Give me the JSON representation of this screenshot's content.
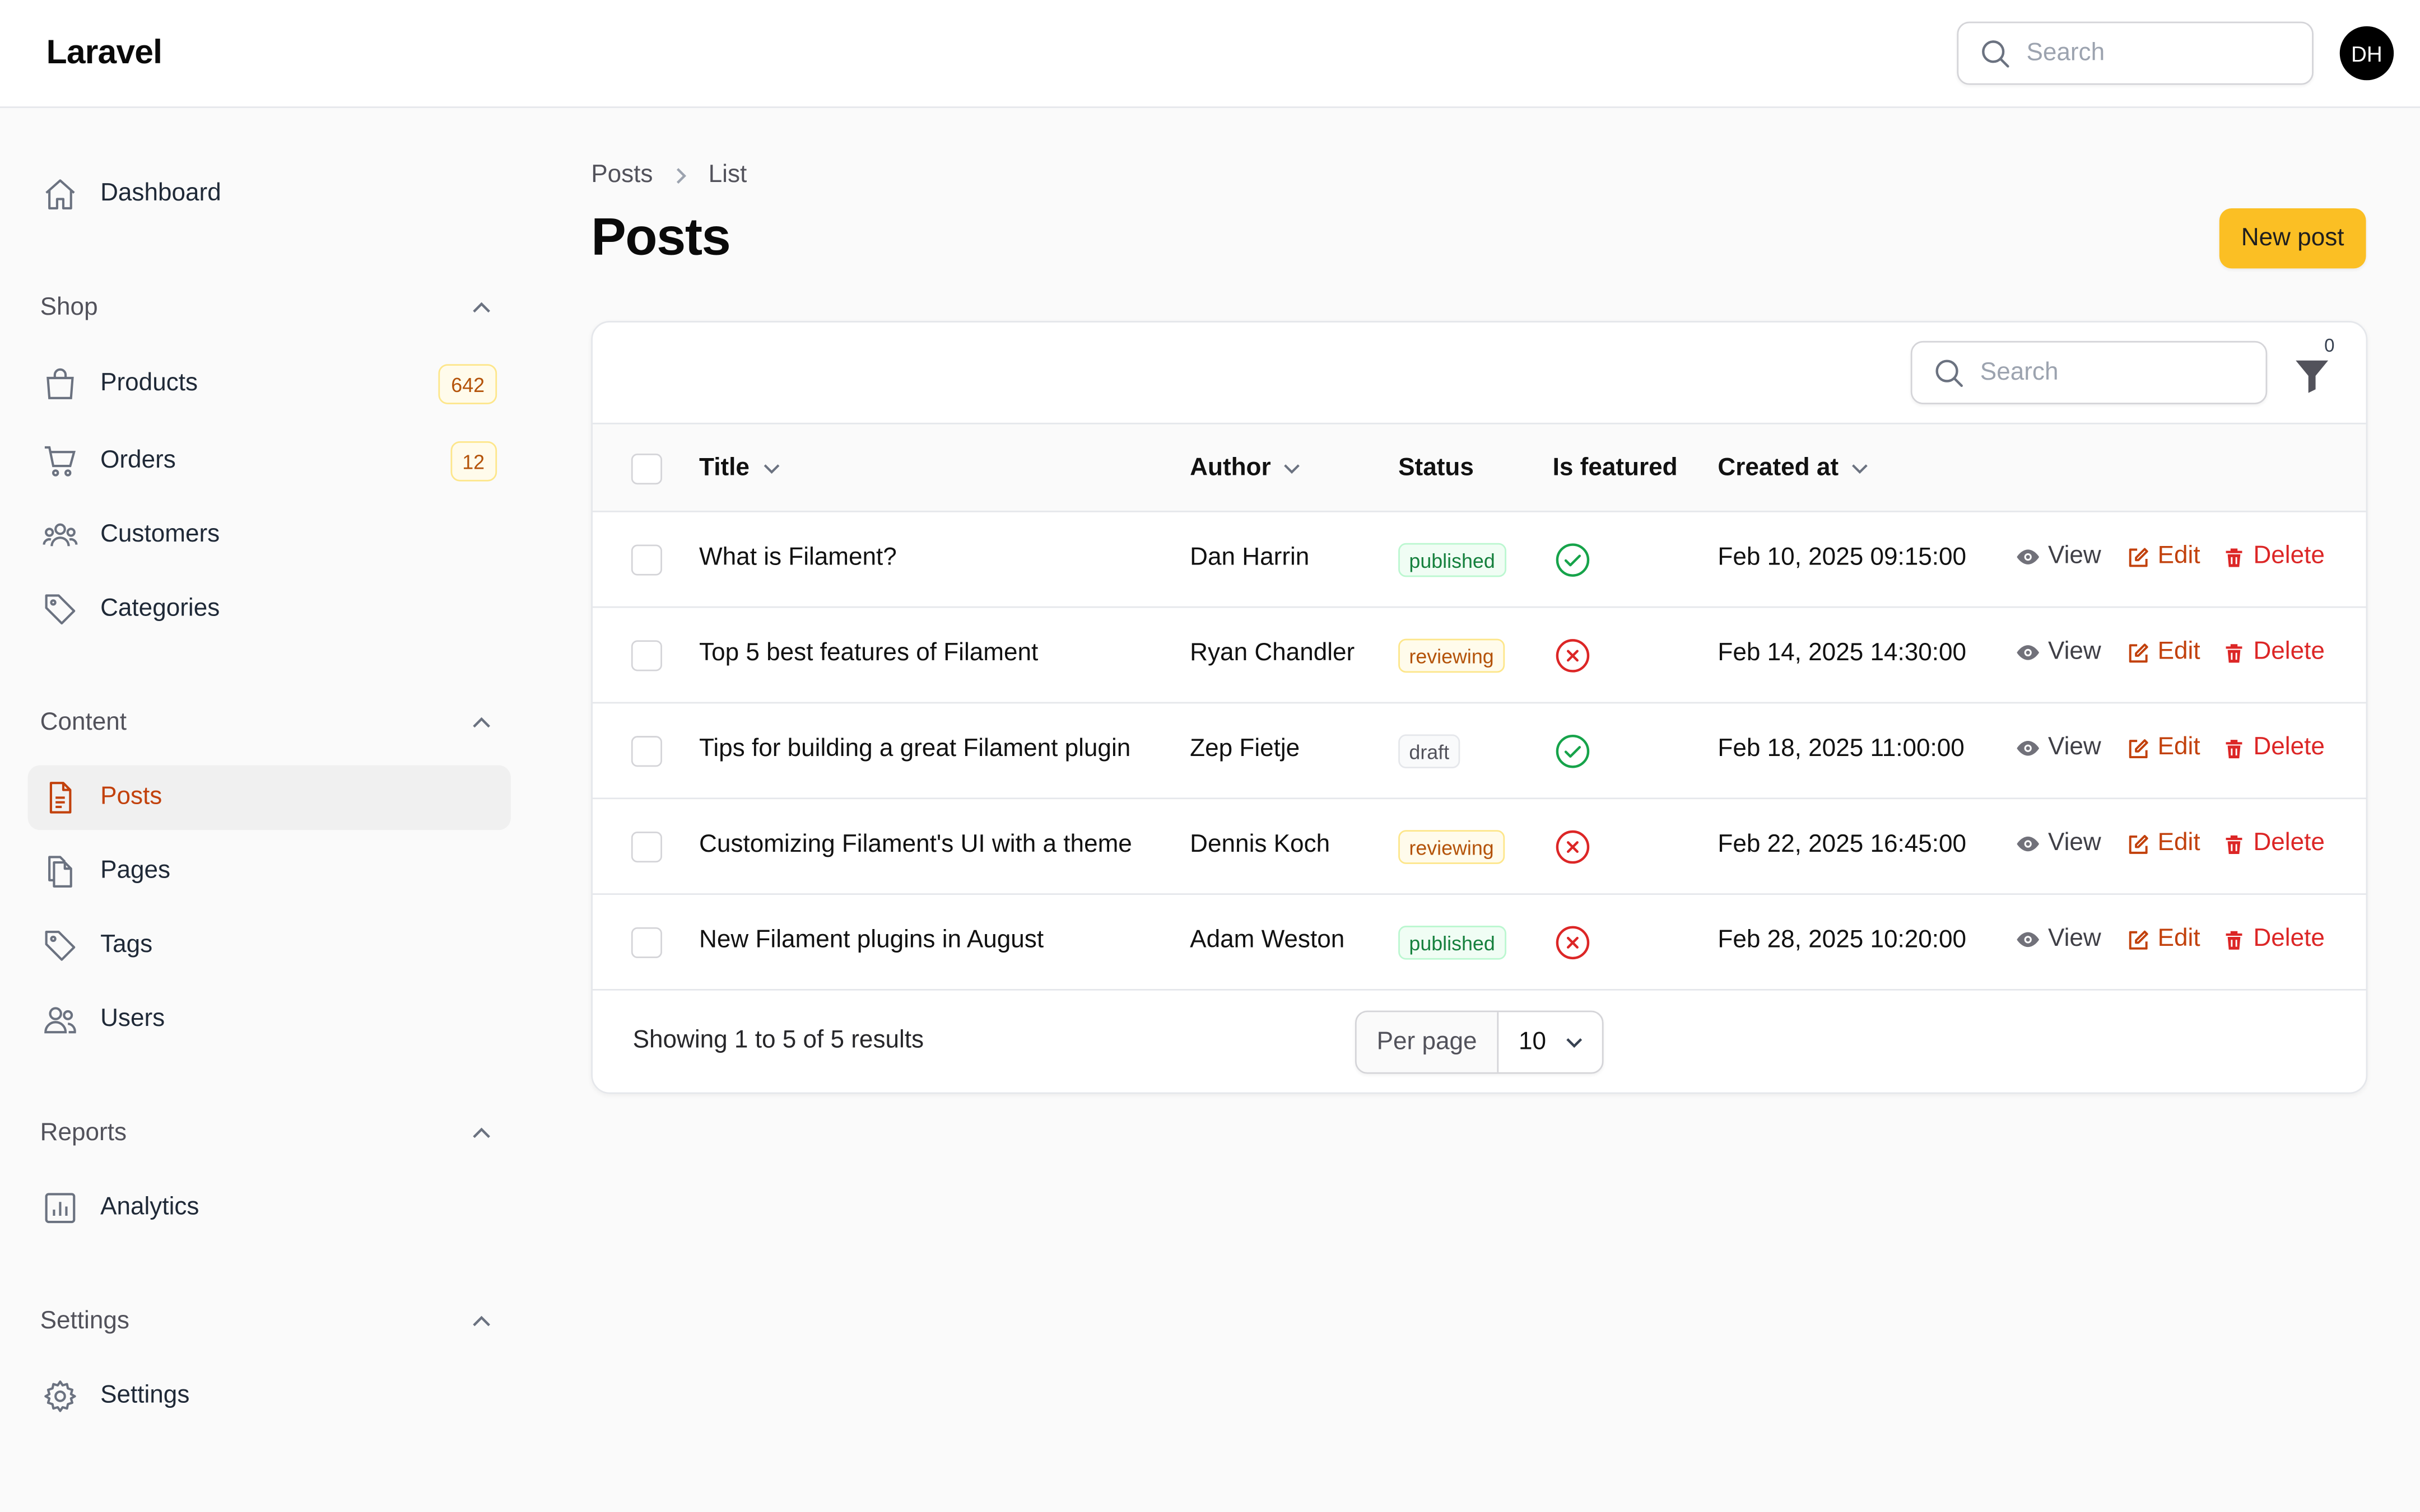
{
  "topbar": {
    "brand": "Laravel",
    "search_placeholder": "Search",
    "avatar_initials": "DH"
  },
  "sidebar": {
    "dashboard": "Dashboard",
    "groups": {
      "shop": "Shop",
      "content": "Content",
      "reports": "Reports",
      "settings": "Settings"
    },
    "items": {
      "products": {
        "label": "Products",
        "badge": "642"
      },
      "orders": {
        "label": "Orders",
        "badge": "12"
      },
      "customers": {
        "label": "Customers"
      },
      "categories": {
        "label": "Categories"
      },
      "posts": {
        "label": "Posts"
      },
      "pages": {
        "label": "Pages"
      },
      "tags": {
        "label": "Tags"
      },
      "users": {
        "label": "Users"
      },
      "analytics": {
        "label": "Analytics"
      },
      "settings": {
        "label": "Settings"
      }
    }
  },
  "breadcrumb": {
    "parent": "Posts",
    "current": "List"
  },
  "page": {
    "title": "Posts",
    "new_button": "New post"
  },
  "table": {
    "search_placeholder": "Search",
    "filter_count": "0",
    "headers": {
      "title": "Title",
      "author": "Author",
      "status": "Status",
      "featured": "Is featured",
      "created": "Created at"
    },
    "actions": {
      "view": "View",
      "edit": "Edit",
      "delete": "Delete"
    },
    "rows": [
      {
        "title": "What is Filament?",
        "author": "Dan Harrin",
        "status": "published",
        "featured": true,
        "created": "Feb 10, 2025 09:15:00"
      },
      {
        "title": "Top 5 best features of Filament",
        "author": "Ryan Chandler",
        "status": "reviewing",
        "featured": false,
        "created": "Feb 14, 2025 14:30:00"
      },
      {
        "title": "Tips for building a great Filament plugin",
        "author": "Zep Fietje",
        "status": "draft",
        "featured": true,
        "created": "Feb 18, 2025 11:00:00"
      },
      {
        "title": "Customizing Filament's UI with a theme",
        "author": "Dennis Koch",
        "status": "reviewing",
        "featured": false,
        "created": "Feb 22, 2025 16:45:00"
      },
      {
        "title": "New Filament plugins in August",
        "author": "Adam Weston",
        "status": "published",
        "featured": false,
        "created": "Feb 28, 2025 10:20:00"
      }
    ],
    "footer": {
      "summary": "Showing 1 to 5 of 5 results",
      "per_page_label": "Per page",
      "per_page_value": "10"
    }
  },
  "colors": {
    "accent": "#c2410c",
    "primary_button": "#fbbf24",
    "success": "#16a34a",
    "danger": "#dc2626"
  }
}
